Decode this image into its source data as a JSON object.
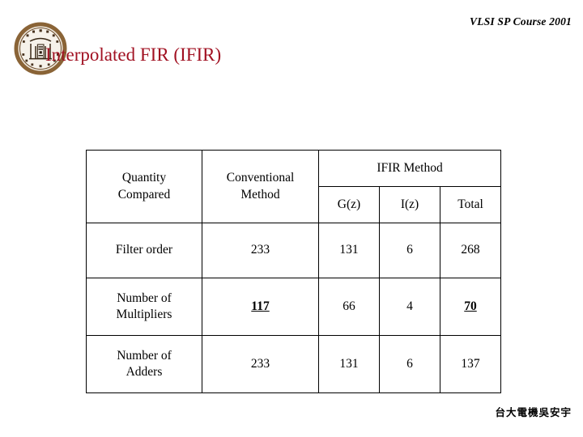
{
  "header": {
    "course_label": "VLSI SP Course 2001"
  },
  "logo": {
    "name": "university-seal",
    "ring_color": "#7B5A33",
    "inner_color": "#F2EDE3",
    "mark_color": "#3A2A18"
  },
  "title": {
    "text": "Interpolated FIR (IFIR)",
    "color": "#A11122"
  },
  "table": {
    "headers": {
      "quantity": "Quantity\nCompared",
      "quantity_line1": "Quantity",
      "quantity_line2": "Compared",
      "conventional_line1": "Conventional",
      "conventional_line2": "Method",
      "group": "IFIR Method",
      "sub": [
        "G(z)",
        "I(z)",
        "Total"
      ]
    },
    "rows": [
      {
        "label": "Filter order",
        "label_line1": "Filter order",
        "label_line2": "",
        "conventional": "233",
        "conventional_emph": false,
        "gz": "131",
        "iz": "6",
        "total": "268",
        "total_emph": false
      },
      {
        "label": "Number of Multipliers",
        "label_line1": "Number of",
        "label_line2": "Multipliers",
        "conventional": "117",
        "conventional_emph": true,
        "gz": "66",
        "iz": "4",
        "total": "70",
        "total_emph": true
      },
      {
        "label": "Number of Adders",
        "label_line1": "Number of",
        "label_line2": "Adders",
        "conventional": "233",
        "conventional_emph": false,
        "gz": "131",
        "iz": "6",
        "total": "137",
        "total_emph": false
      }
    ]
  },
  "footer": {
    "credit": "台大電機吳安宇"
  }
}
